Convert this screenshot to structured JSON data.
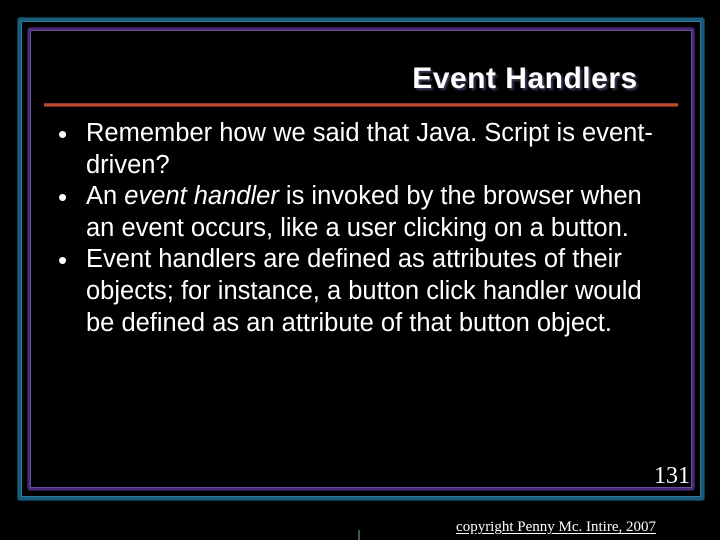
{
  "title": "Event Handlers",
  "bullets": [
    {
      "pre": "Remember how we said that Java. Script is event-driven?",
      "em": "",
      "post": ""
    },
    {
      "pre": "An ",
      "em": "event handler",
      "post": " is invoked by the browser when an event occurs, like a user clicking on a button."
    },
    {
      "pre": "Event handlers are defined as attributes of their objects; for instance, a button click handler would be defined as an attribute of that button object.",
      "em": "",
      "post": ""
    }
  ],
  "page_number": "131",
  "copyright": "copyright Penny Mc. Intire, 2007"
}
